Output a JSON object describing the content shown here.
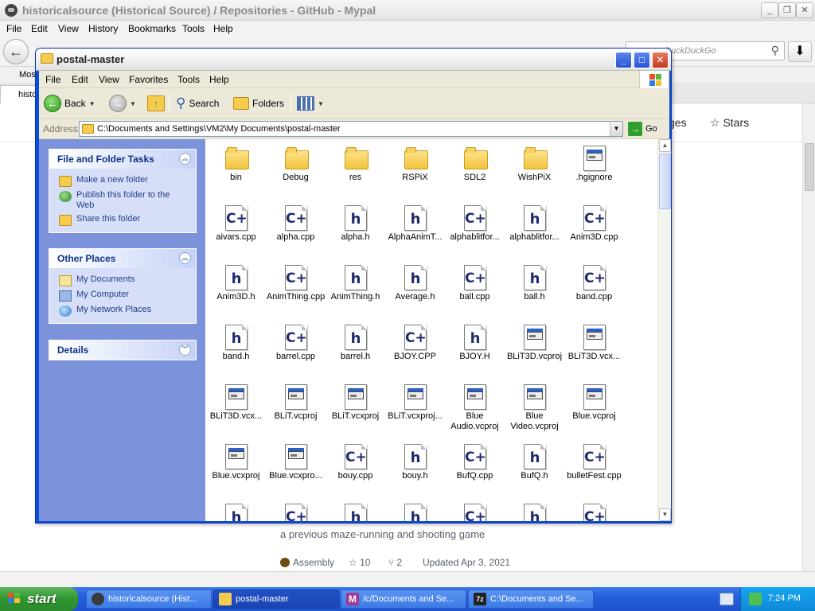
{
  "browser": {
    "title": "historicalsource (Historical Source) / Repositories - GitHub - Mypal",
    "menu": [
      "File",
      "Edit",
      "View",
      "History",
      "Bookmarks",
      "Tools",
      "Help"
    ],
    "search_placeholder": "DuckDuckGo",
    "bookmark_label": "Most",
    "tab_label": "histo",
    "page": {
      "nav_partial": "ges",
      "stars_label": "Stars",
      "repo_description": "a previous maze-running and shooting game",
      "language": "Assembly",
      "language_color": "#6e4c13",
      "stars": "10",
      "forks": "2",
      "updated": "Updated Apr 3, 2021"
    }
  },
  "explorer": {
    "title": "postal-master",
    "menu": [
      "File",
      "Edit",
      "View",
      "Favorites",
      "Tools",
      "Help"
    ],
    "toolbar": {
      "back": "Back",
      "search": "Search",
      "folders": "Folders"
    },
    "address": {
      "label": "Address",
      "path": "C:\\Documents and Settings\\VM2\\My Documents\\postal-master",
      "go": "Go"
    },
    "tasks": {
      "file_folder": {
        "title": "File and Folder Tasks",
        "items": [
          "Make a new folder",
          "Publish this folder to the Web",
          "Share this folder"
        ]
      },
      "other_places": {
        "title": "Other Places",
        "items": [
          "My Documents",
          "My Computer",
          "My Network Places"
        ]
      },
      "details": {
        "title": "Details"
      }
    },
    "files": [
      {
        "name": "bin",
        "type": "folder"
      },
      {
        "name": "Debug",
        "type": "folder"
      },
      {
        "name": "res",
        "type": "folder"
      },
      {
        "name": "RSPiX",
        "type": "folder"
      },
      {
        "name": "SDL2",
        "type": "folder"
      },
      {
        "name": "WishPiX",
        "type": "folder"
      },
      {
        "name": ".hgignore",
        "type": "win"
      },
      {
        "name": "aivars.cpp",
        "type": "cpp"
      },
      {
        "name": "alpha.cpp",
        "type": "cpp"
      },
      {
        "name": "alpha.h",
        "type": "h"
      },
      {
        "name": "AlphaAnimT...",
        "type": "h"
      },
      {
        "name": "alphablitfor...",
        "type": "cpp"
      },
      {
        "name": "alphablitfor...",
        "type": "h"
      },
      {
        "name": "Anim3D.cpp",
        "type": "cpp"
      },
      {
        "name": "Anim3D.h",
        "type": "h"
      },
      {
        "name": "AnimThing.cpp",
        "type": "cpp"
      },
      {
        "name": "AnimThing.h",
        "type": "h"
      },
      {
        "name": "Average.h",
        "type": "h"
      },
      {
        "name": "ball.cpp",
        "type": "cpp"
      },
      {
        "name": "ball.h",
        "type": "h"
      },
      {
        "name": "band.cpp",
        "type": "cpp"
      },
      {
        "name": "band.h",
        "type": "h"
      },
      {
        "name": "barrel.cpp",
        "type": "cpp"
      },
      {
        "name": "barrel.h",
        "type": "h"
      },
      {
        "name": "BJOY.CPP",
        "type": "cpp"
      },
      {
        "name": "BJOY.H",
        "type": "h"
      },
      {
        "name": "BLiT3D.vcproj",
        "type": "win"
      },
      {
        "name": "BLiT3D.vcx...",
        "type": "win"
      },
      {
        "name": "BLiT3D.vcx...",
        "type": "win"
      },
      {
        "name": "BLiT.vcproj",
        "type": "win"
      },
      {
        "name": "BLiT.vcxproj",
        "type": "win"
      },
      {
        "name": "BLiT.vcxproj...",
        "type": "win"
      },
      {
        "name": "Blue Audio.vcproj",
        "type": "win"
      },
      {
        "name": "Blue Video.vcproj",
        "type": "win"
      },
      {
        "name": "Blue.vcproj",
        "type": "win"
      },
      {
        "name": "Blue.vcxproj",
        "type": "win"
      },
      {
        "name": "Blue.vcxpro...",
        "type": "win"
      },
      {
        "name": "bouy.cpp",
        "type": "cpp"
      },
      {
        "name": "bouy.h",
        "type": "h"
      },
      {
        "name": "BufQ.cpp",
        "type": "cpp"
      },
      {
        "name": "BufQ.h",
        "type": "h"
      },
      {
        "name": "bulletFest.cpp",
        "type": "cpp"
      },
      {
        "name": "",
        "type": "h"
      },
      {
        "name": "",
        "type": "cpp"
      },
      {
        "name": "",
        "type": "h"
      },
      {
        "name": "",
        "type": "h"
      },
      {
        "name": "",
        "type": "cpp"
      },
      {
        "name": "",
        "type": "h"
      },
      {
        "name": "",
        "type": "cpp"
      }
    ]
  },
  "taskbar": {
    "start": "start",
    "tasks": [
      {
        "label": "historicalsource (Hist...",
        "icon_color": "#3b3b3b"
      },
      {
        "label": "postal-master",
        "icon_color": "#f5cc4e"
      },
      {
        "label": "/c/Documents and Se...",
        "icon_color": "#a23a8f"
      },
      {
        "label": "C:\\Documents and Se...",
        "icon_color": "#222222"
      }
    ],
    "clock": "7:24 PM"
  }
}
